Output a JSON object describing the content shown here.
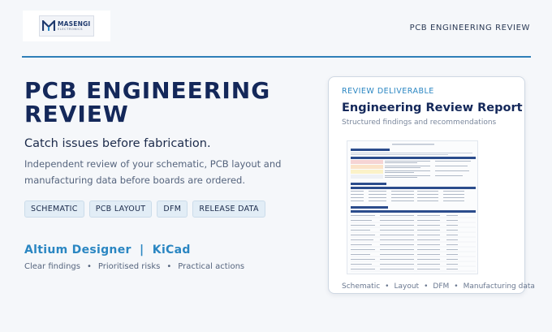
{
  "brand": {
    "logo_name": "MASENGI",
    "logo_sub": "ELECTRONICS"
  },
  "header": {
    "top_title": "PCB ENGINEERING REVIEW"
  },
  "hero": {
    "title": "PCB ENGINEERING REVIEW",
    "tagline": "Catch issues before fabrication.",
    "description": "Independent review of your schematic, PCB layout and manufacturing data before boards are ordered.",
    "pills": [
      "SCHEMATIC",
      "PCB LAYOUT",
      "DFM",
      "RELEASE DATA"
    ],
    "tools": "Altium Designer  |  KiCad",
    "features": [
      "Clear findings",
      "Prioritised risks",
      "Practical actions"
    ]
  },
  "card": {
    "eyebrow": "REVIEW DELIVERABLE",
    "title": "Engineering Review Report",
    "subtitle": "Structured findings and recommendations",
    "footer": [
      "Schematic",
      "Layout",
      "DFM",
      "Manufacturing data"
    ]
  },
  "colors": {
    "accent": "#2a86c2",
    "title": "#14285a",
    "severity_high": "#f6d4d4",
    "severity_medium": "#fbe3c8",
    "severity_low": "#fbf2c8"
  },
  "icons": {
    "logo": "m-monogram-icon",
    "separator": "bullet-dot"
  }
}
